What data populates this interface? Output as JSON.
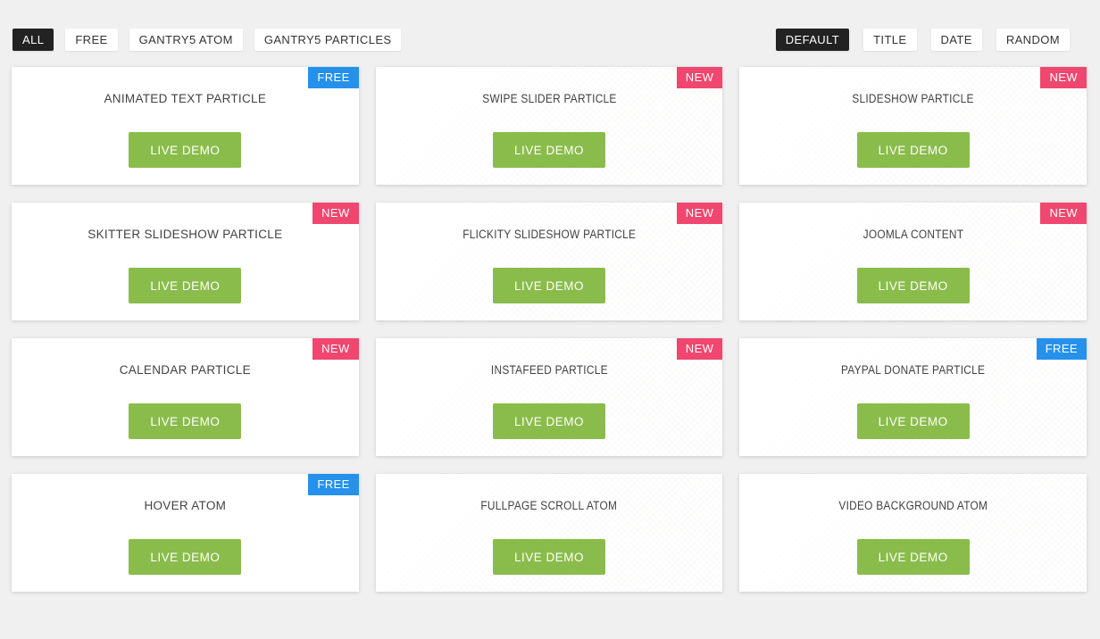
{
  "toolbar": {
    "filters": [
      {
        "label": "ALL",
        "active": true
      },
      {
        "label": "FREE",
        "active": false
      },
      {
        "label": "GANTRY5 ATOM",
        "active": false
      },
      {
        "label": "GANTRY5 PARTICLES",
        "active": false
      }
    ],
    "sorters": [
      {
        "label": "DEFAULT",
        "active": true
      },
      {
        "label": "TITLE",
        "active": false
      },
      {
        "label": "DATE",
        "active": false
      },
      {
        "label": "RANDOM",
        "active": false
      }
    ]
  },
  "cards": [
    {
      "title": "ANIMATED TEXT PARTICLE",
      "badge": "FREE",
      "button": "LIVE DEMO"
    },
    {
      "title": "SWIPE SLIDER PARTICLE",
      "badge": "NEW",
      "button": "LIVE DEMO"
    },
    {
      "title": "SLIDESHOW PARTICLE",
      "badge": "NEW",
      "button": "LIVE DEMO"
    },
    {
      "title": "SKITTER SLIDESHOW PARTICLE",
      "badge": "NEW",
      "button": "LIVE DEMO"
    },
    {
      "title": "FLICKITY SLIDESHOW PARTICLE",
      "badge": "NEW",
      "button": "LIVE DEMO"
    },
    {
      "title": "JOOMLA CONTENT",
      "badge": "NEW",
      "button": "LIVE DEMO"
    },
    {
      "title": "CALENDAR PARTICLE",
      "badge": "NEW",
      "button": "LIVE DEMO"
    },
    {
      "title": "INSTAFEED PARTICLE",
      "badge": "NEW",
      "button": "LIVE DEMO"
    },
    {
      "title": "PAYPAL DONATE PARTICLE",
      "badge": "FREE",
      "button": "LIVE DEMO"
    },
    {
      "title": "HOVER ATOM",
      "badge": "FREE",
      "button": "LIVE DEMO"
    },
    {
      "title": "FULLPAGE SCROLL ATOM",
      "badge": null,
      "button": "LIVE DEMO"
    },
    {
      "title": "VIDEO BACKGROUND ATOM",
      "badge": null,
      "button": "LIVE DEMO"
    }
  ],
  "colors": {
    "page_bg": "#f0f0f0",
    "badge_new": "#ef476f",
    "badge_free": "#2591ea",
    "demo_green": "#8abc4b",
    "chip_active_bg": "#222222",
    "chip_active_text": "#ffffff",
    "chip_text": "#333333",
    "title_text": "#424242"
  }
}
